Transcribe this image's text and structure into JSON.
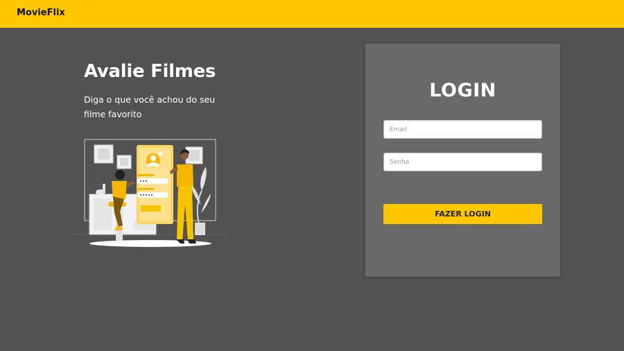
{
  "navbar": {
    "brand": "MovieFlix"
  },
  "hero": {
    "title": "Avalie Filmes",
    "subtitle": "Diga o que você achou do seu filme favorito"
  },
  "login": {
    "title": "LOGIN",
    "email_placeholder": "Email",
    "password_placeholder": "Senha",
    "submit_label": "FAZER LOGIN"
  },
  "colors": {
    "accent": "#FFC700",
    "background": "#525252",
    "card": "#696969"
  }
}
